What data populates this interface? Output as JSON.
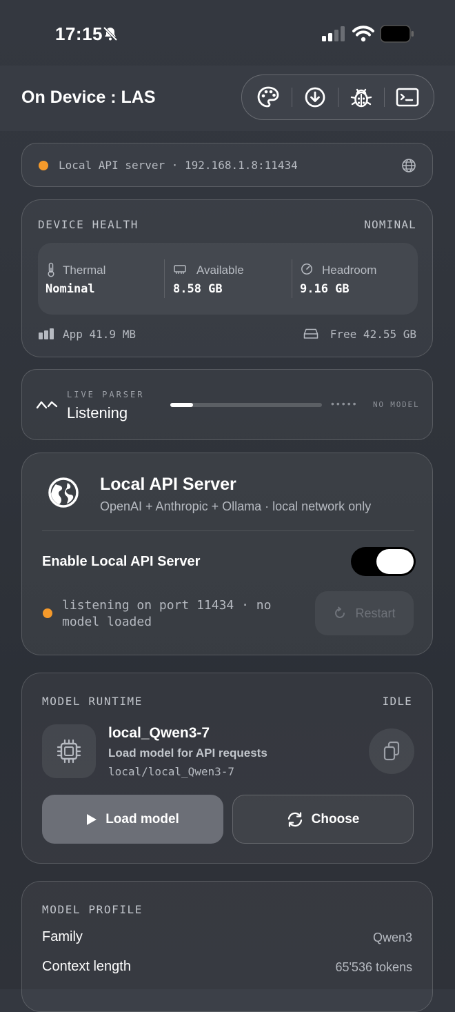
{
  "status_bar": {
    "time": "17:15"
  },
  "header": {
    "title": "On Device : LAS"
  },
  "toolbar": {
    "icons": [
      "palette-icon",
      "download-icon",
      "bug-icon",
      "terminal-icon"
    ]
  },
  "server_banner": {
    "text": "Local API server · 192.168.1.8:11434",
    "status_color": "#f59a2b"
  },
  "device_health": {
    "label": "DEVICE HEALTH",
    "status": "NOMINAL",
    "metrics": [
      {
        "name": "Thermal",
        "value": "Nominal"
      },
      {
        "name": "Available",
        "value": "8.58 GB"
      },
      {
        "name": "Headroom",
        "value": "9.16 GB"
      }
    ],
    "app_usage": "App 41.9 MB",
    "free_storage": "Free 42.55 GB"
  },
  "live_parser": {
    "label": "LIVE PARSER",
    "state": "Listening",
    "model_status": "NO MODEL",
    "progress": 0.15
  },
  "local_api_server": {
    "title": "Local API Server",
    "subtitle": "OpenAI + Anthropic + Ollama · local network only",
    "toggle_label": "Enable Local API Server",
    "enabled": true,
    "status_line1": "listening on port 11434 · no",
    "status_line2": "model loaded",
    "restart_label": "Restart"
  },
  "model_runtime": {
    "label": "MODEL RUNTIME",
    "status": "IDLE",
    "model_name": "local_Qwen3-7",
    "description": "Load model for API requests",
    "path": "local/local_Qwen3-7",
    "load_label": "Load model",
    "choose_label": "Choose"
  },
  "model_profile": {
    "label": "MODEL PROFILE",
    "rows": [
      {
        "key": "Family",
        "value": "Qwen3"
      },
      {
        "key": "Context length",
        "value": "65'536 tokens"
      }
    ]
  },
  "colors": {
    "accent_orange": "#f59a2b",
    "background": "#30343b"
  }
}
